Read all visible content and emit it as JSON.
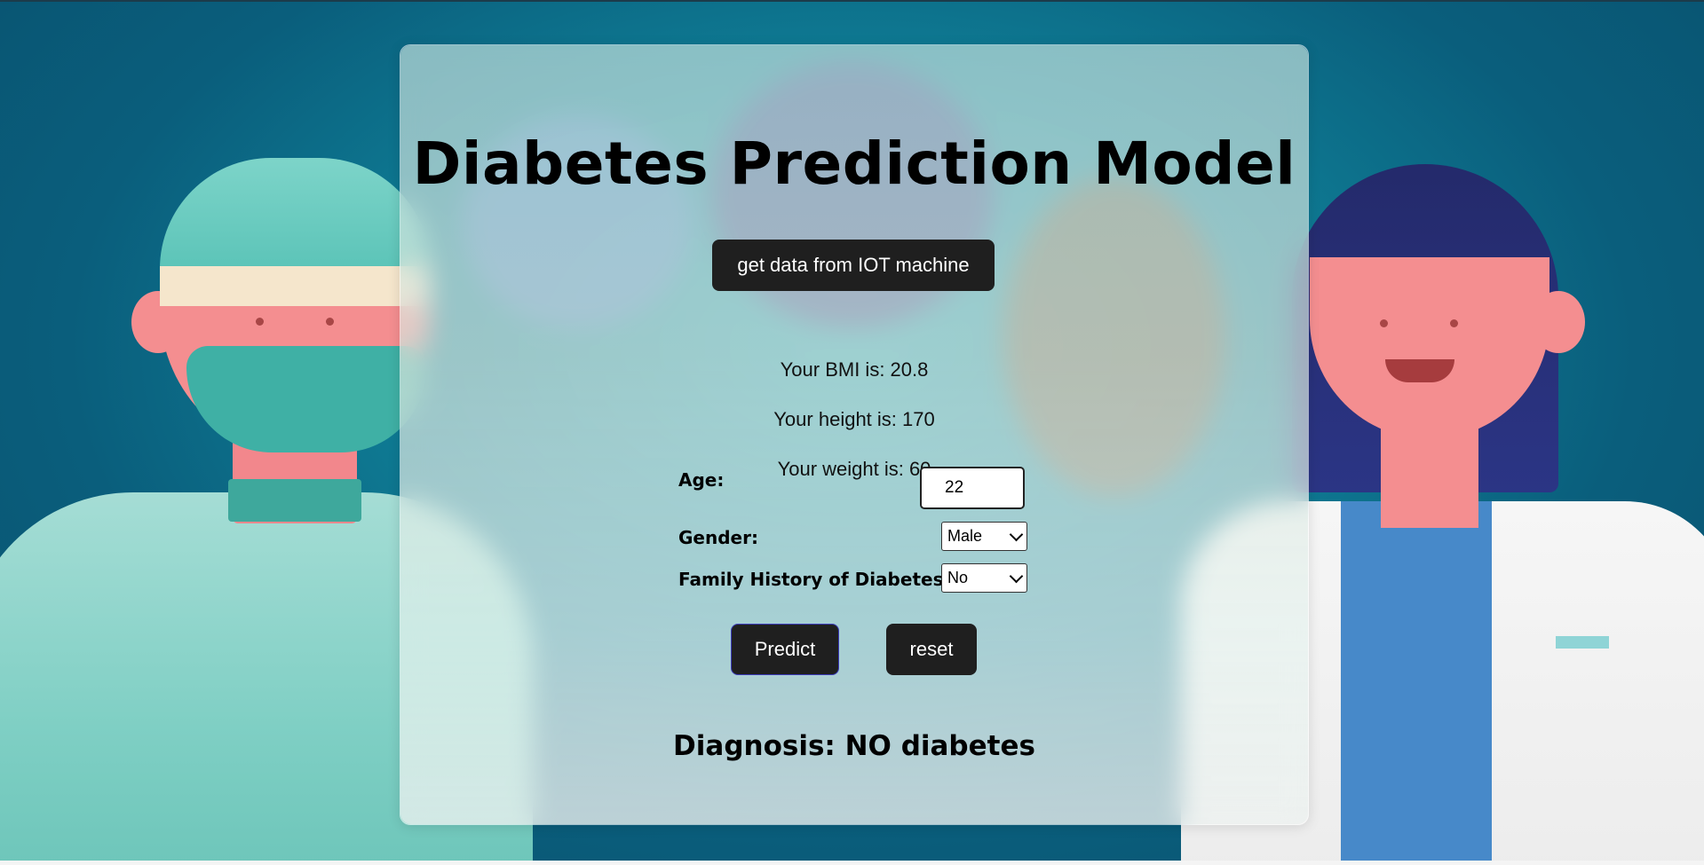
{
  "page": {
    "title": "Diabetes Prediction Model",
    "iot_button_label": "get data from IOT machine"
  },
  "readings": {
    "bmi_text": "Your BMI is: 20.8",
    "height_text": "Your height is: 170",
    "weight_text": "Your weight is: 60"
  },
  "form": {
    "age_label": "Age:",
    "age_value": "22",
    "gender_label": "Gender:",
    "gender_selected": "Male",
    "family_history_label": "Family History of Diabetes:",
    "family_history_selected": "No"
  },
  "actions": {
    "predict_label": "Predict",
    "reset_label": "reset"
  },
  "result": {
    "diagnosis_text": "Diagnosis: NO diabetes"
  },
  "colors": {
    "button_bg": "#1f1f1f",
    "background": "#0b5b78",
    "accent_teal": "#5cc4b8"
  }
}
